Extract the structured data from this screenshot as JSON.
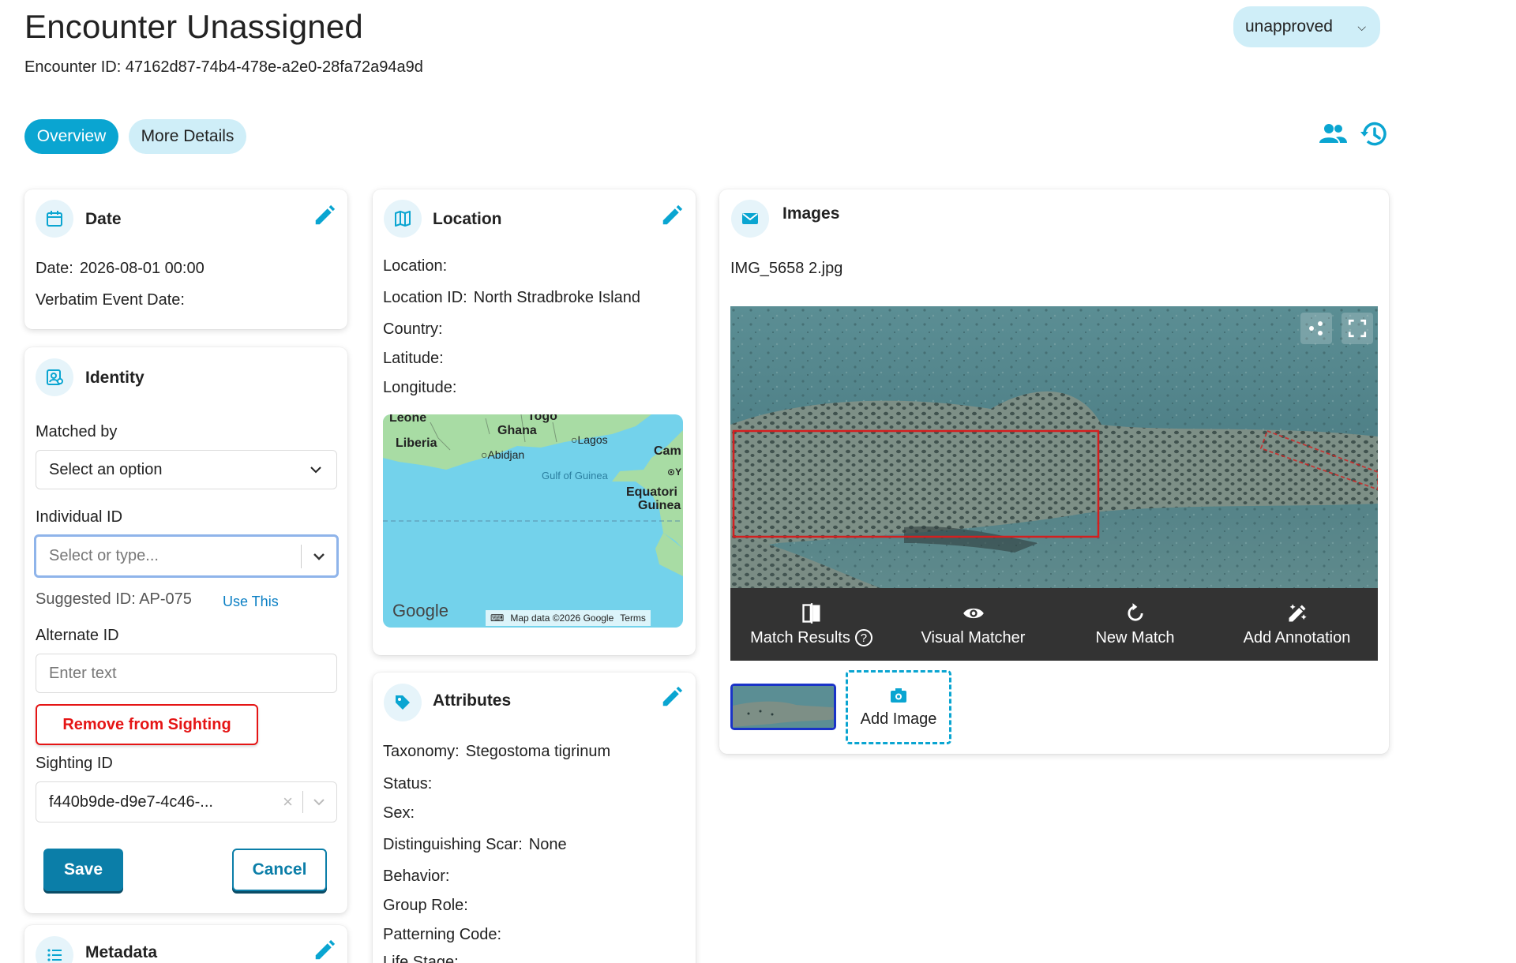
{
  "header": {
    "title": "Encounter Unassigned",
    "encounter_id": "Encounter ID: 47162d87-74b4-478e-a2e0-28fa72a94a9d",
    "status_value": "unapproved"
  },
  "tabs": [
    {
      "label": "Overview",
      "active": true
    },
    {
      "label": "More Details",
      "active": false
    }
  ],
  "date_card": {
    "title": "Date",
    "date_label": "Date:",
    "date_value": "2026-08-01 00:00",
    "verbatim_label": "Verbatim Event Date:"
  },
  "identity_card": {
    "title": "Identity",
    "matched_by_label": "Matched by",
    "matched_by_value": "Select an option",
    "individual_id_label": "Individual ID",
    "individual_id_placeholder": "Select or type...",
    "suggested_label": "Suggested ID: AP-075",
    "use_this": "Use This",
    "alternate_id_label": "Alternate ID",
    "alternate_id_placeholder": "Enter text",
    "remove_button": "Remove from Sighting",
    "sighting_id_label": "Sighting ID",
    "sighting_id_value": "f440b9de-d9e7-4c46-...",
    "save_button": "Save",
    "cancel_button": "Cancel"
  },
  "metadata_card": {
    "title": "Metadata"
  },
  "location_card": {
    "title": "Location",
    "location_label": "Location:",
    "location_id_label": "Location ID:",
    "location_id_value": "North Stradbroke Island",
    "country_label": "Country:",
    "latitude_label": "Latitude:",
    "longitude_label": "Longitude:",
    "map": {
      "labels": {
        "leone": "Leone",
        "togo": "Togo",
        "ghana": "Ghana",
        "liberia": "Liberia",
        "lagos": "Lagos",
        "abidjan": "Abidjan",
        "cam": "Cam",
        "gulf": "Gulf of Guinea",
        "eq1": "Equatori",
        "eq2": "Guinea",
        "y": "Y"
      },
      "brand": "Google",
      "attribution": "Map data ©2026 Google",
      "terms": "Terms"
    }
  },
  "attributes_card": {
    "title": "Attributes",
    "taxonomy_label": "Taxonomy:",
    "taxonomy_value": "Stegostoma tigrinum",
    "status_label": "Status:",
    "sex_label": "Sex:",
    "scar_label": "Distinguishing Scar:",
    "scar_value": "None",
    "behavior_label": "Behavior:",
    "group_role_label": "Group Role:",
    "patterning_label": "Patterning Code:",
    "life_stage_label": "Life Stage:"
  },
  "images_card": {
    "title": "Images",
    "filename": "IMG_5658 2.jpg",
    "tools": [
      {
        "label": "Match Results",
        "icon": "compare-icon"
      },
      {
        "label": "Visual Matcher",
        "icon": "eye-icon"
      },
      {
        "label": "New Match",
        "icon": "refresh-icon"
      },
      {
        "label": "Add Annotation",
        "icon": "annotate-icon"
      }
    ],
    "add_image_label": "Add Image"
  },
  "colors": {
    "accent": "#0aa5d1",
    "accent_light": "#cfeef8",
    "danger": "#e51515",
    "primary_button": "#0b7ea8"
  }
}
